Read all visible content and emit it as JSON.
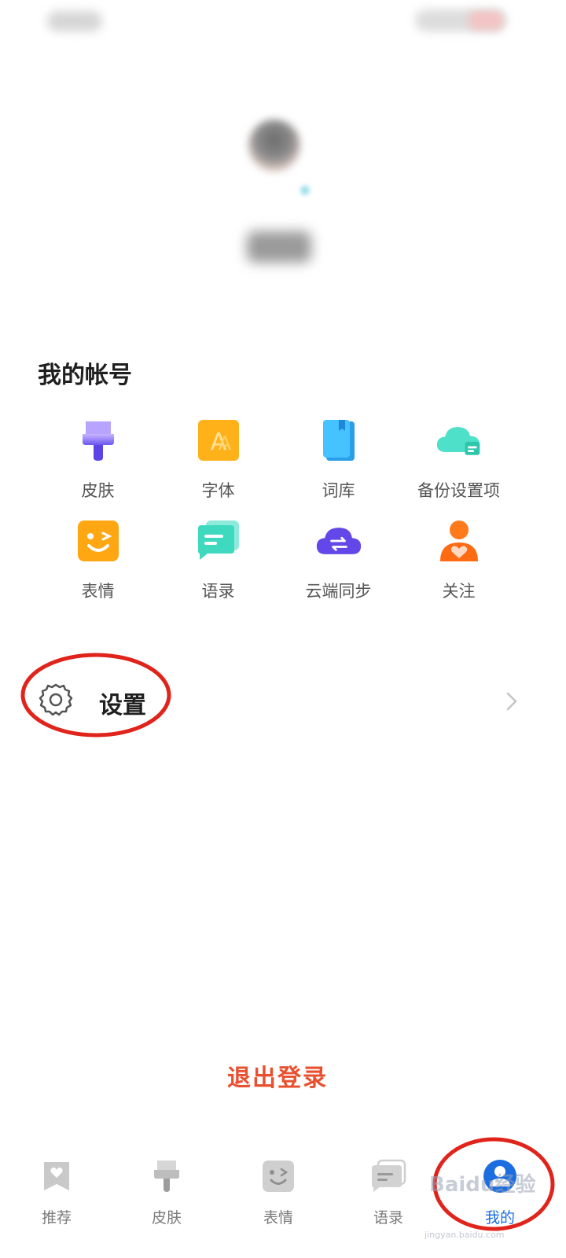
{
  "section": {
    "title": "我的帐号"
  },
  "grid": {
    "items": [
      {
        "label": "皮肤",
        "icon": "brush-icon"
      },
      {
        "label": "字体",
        "icon": "font-icon"
      },
      {
        "label": "词库",
        "icon": "book-icon"
      },
      {
        "label": "备份设置项",
        "icon": "cloud-backup-icon"
      },
      {
        "label": "表情",
        "icon": "wink-face-icon"
      },
      {
        "label": "语录",
        "icon": "chat-icon"
      },
      {
        "label": "云端同步",
        "icon": "cloud-sync-icon"
      },
      {
        "label": "关注",
        "icon": "follow-user-icon"
      }
    ]
  },
  "settings": {
    "label": "设置"
  },
  "logout": {
    "label": "退出登录"
  },
  "nav": {
    "items": [
      {
        "label": "推荐",
        "icon": "recommend-icon"
      },
      {
        "label": "皮肤",
        "icon": "brush-icon"
      },
      {
        "label": "表情",
        "icon": "wink-face-icon"
      },
      {
        "label": "语录",
        "icon": "chat-icon"
      },
      {
        "label": "我的",
        "icon": "user-icon",
        "active": true
      }
    ]
  },
  "watermark": {
    "text": "Baidu经验",
    "sub": "jingyan.baidu.com"
  },
  "colors": {
    "accent_blue": "#1b6de0",
    "logout_red": "#e9502f",
    "annotation_red": "#e0241b"
  }
}
